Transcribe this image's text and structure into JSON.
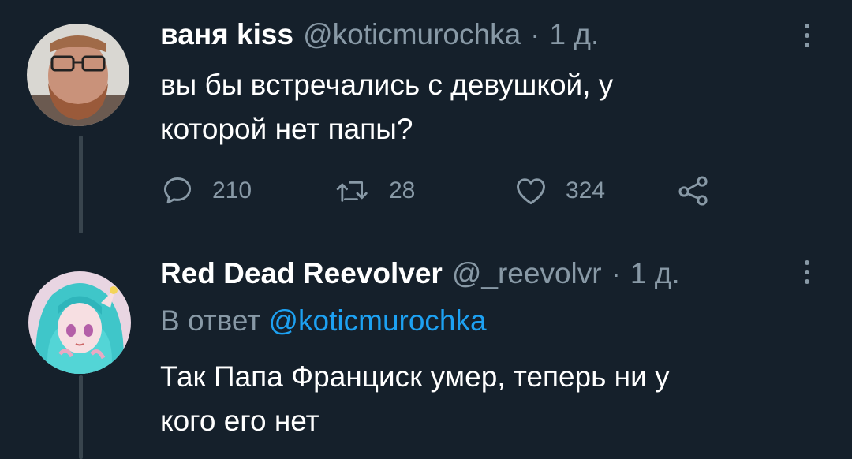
{
  "tweets": [
    {
      "author_name": "ваня kiss",
      "handle": "@koticmurochka",
      "separator": "·",
      "time": "1 д.",
      "text_line1": "вы бы встречались с девушкой, у",
      "text_line2": "которой нет папы?",
      "reply_count": "210",
      "retweet_count": "28",
      "like_count": "324",
      "icons": [
        "comment-icon",
        "retweet-icon",
        "heart-icon",
        "share-icon",
        "more-icon"
      ]
    },
    {
      "author_name": "Red Dead Reevolver",
      "handle": "@_reevolvr",
      "separator": "·",
      "time": "1 д.",
      "reply_prefix": "В ответ",
      "reply_mention": "@koticmurochka",
      "text_line1": "Так Папа Франциск умер, теперь ни у",
      "text_line2": "кого его нет"
    }
  ],
  "colors": {
    "background": "#15202b",
    "text": "#ffffff",
    "secondary": "#8899a6",
    "link": "#1da1f2",
    "thread_line": "#38444d"
  }
}
